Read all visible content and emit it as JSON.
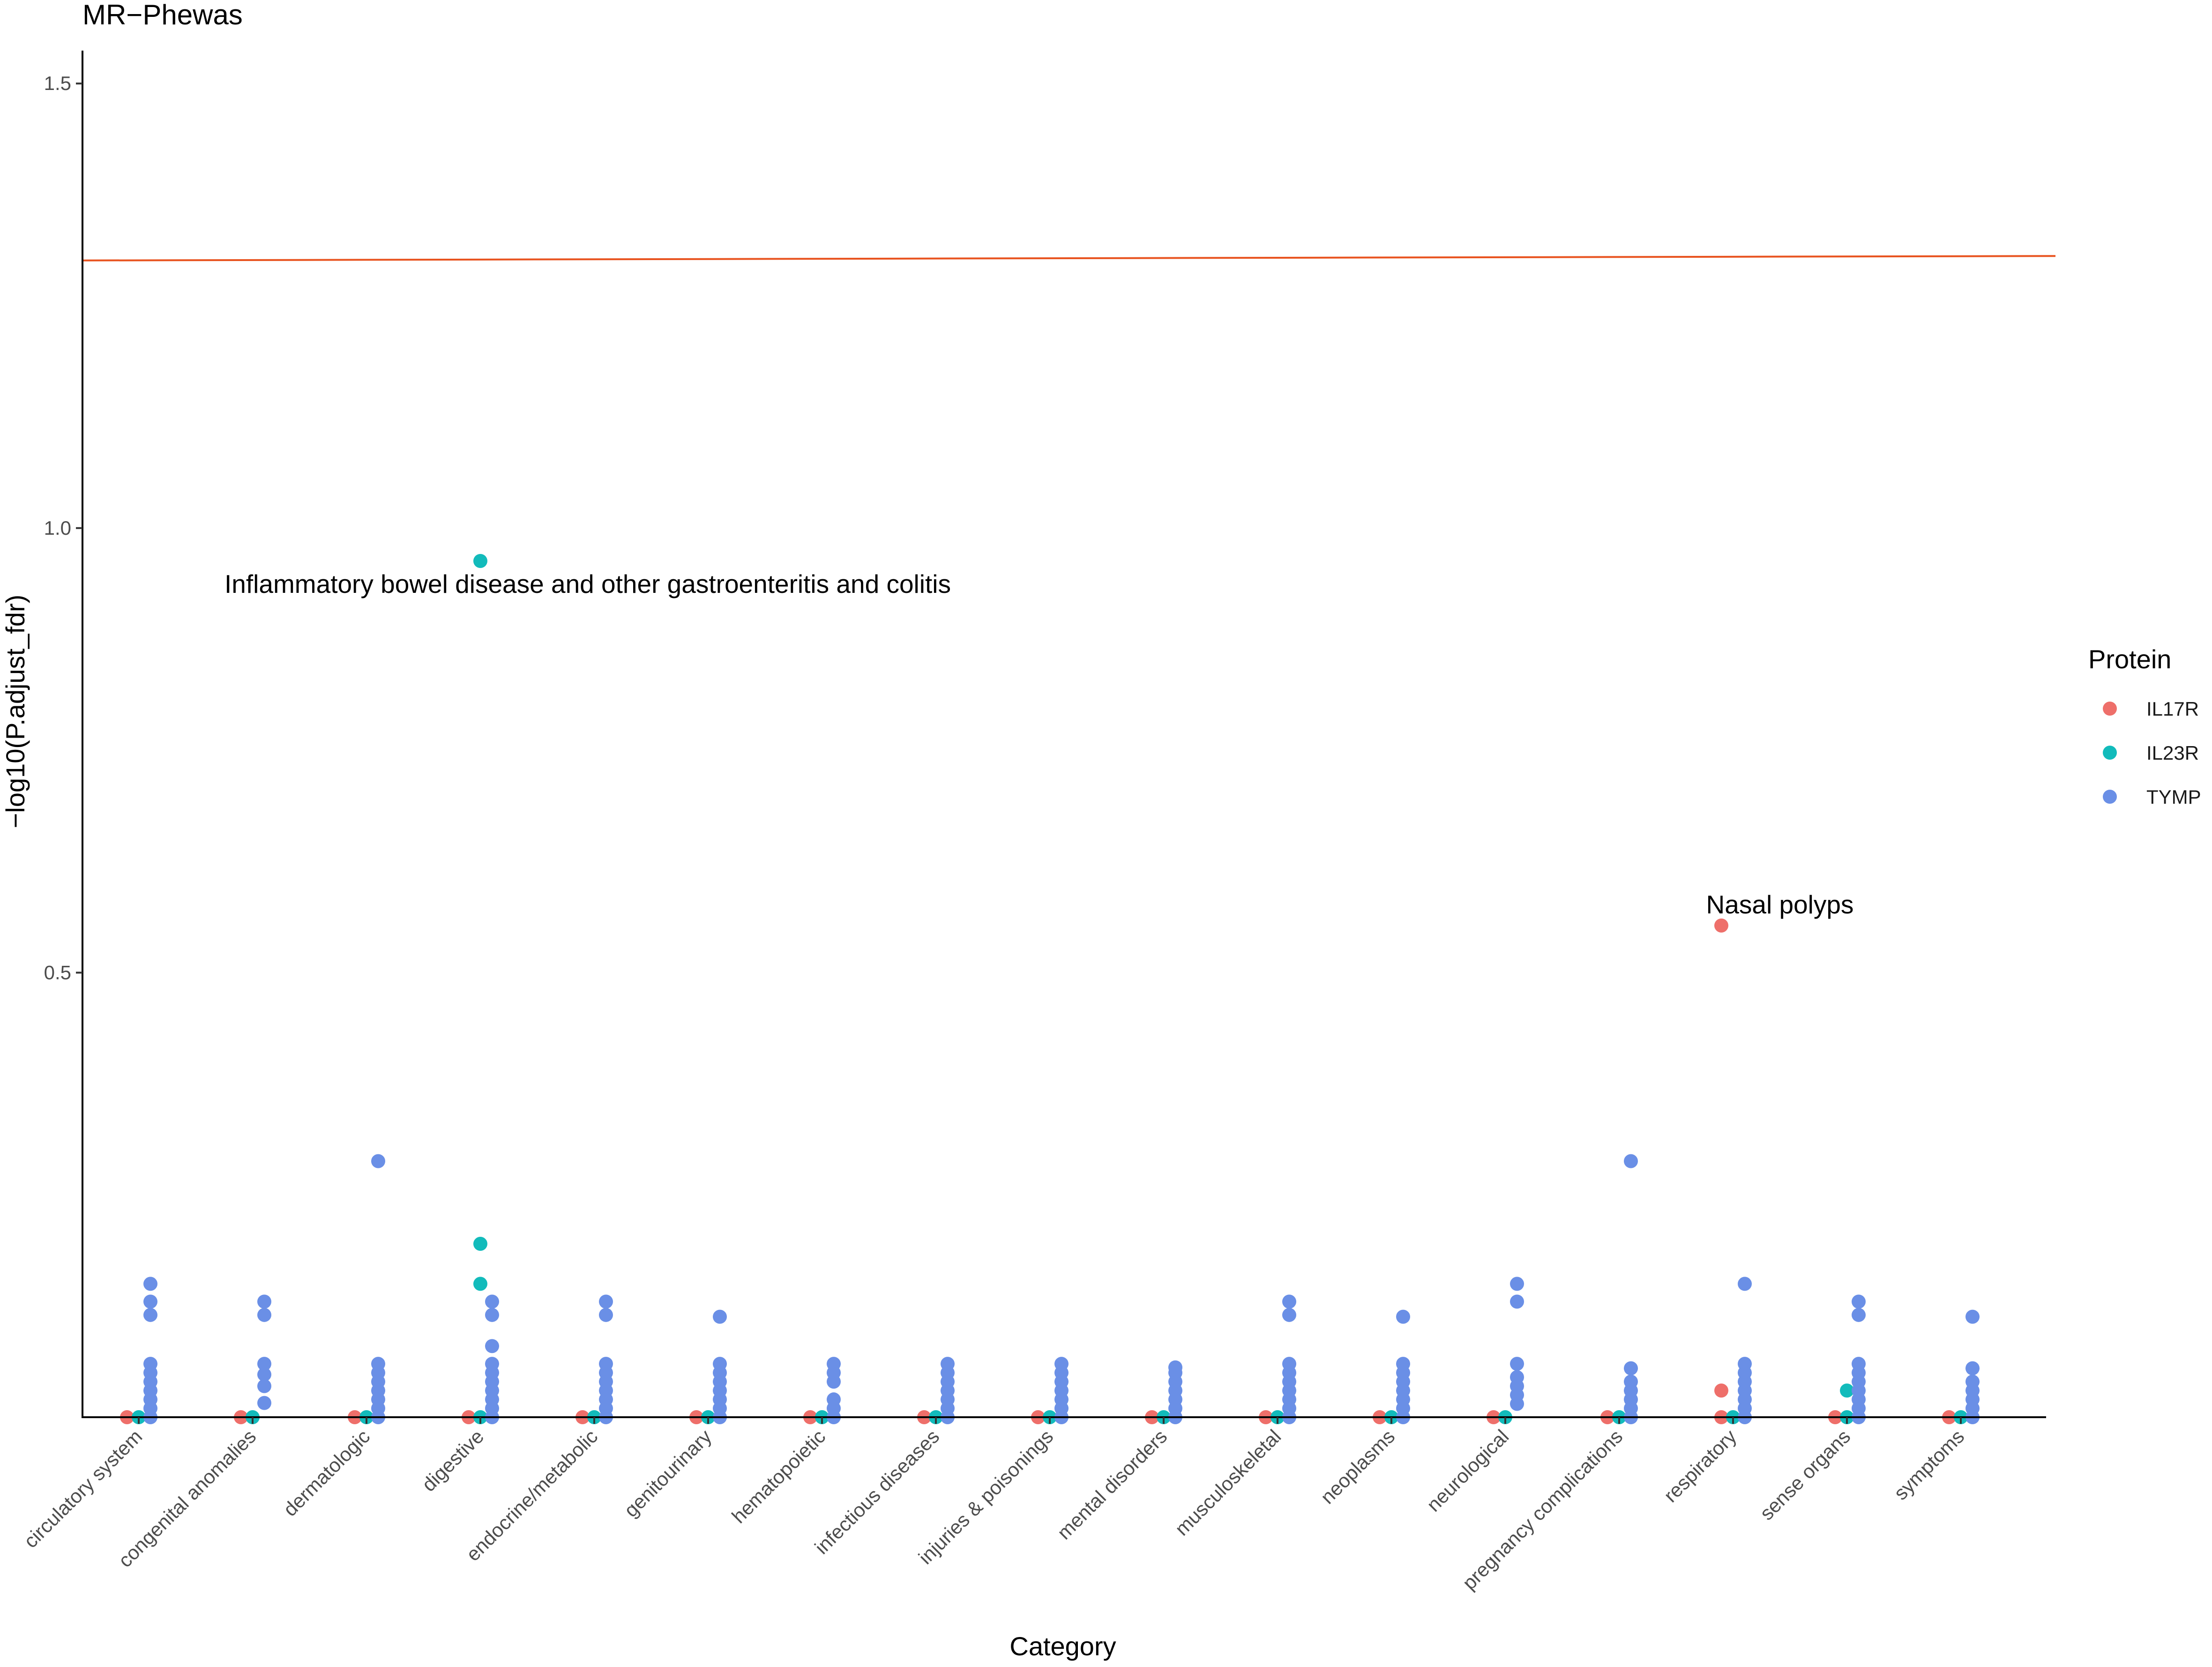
{
  "chart_data": {
    "type": "scatter",
    "title": "MR−Phewas",
    "xlabel": "Category",
    "ylabel": "−log10(P.adjust_fdr)",
    "ylim": [
      0,
      1.537
    ],
    "yticks": [
      0.5,
      1.0,
      1.5
    ],
    "ytick_labels": [
      "0.5",
      "1.0",
      "1.5"
    ],
    "categories": [
      "circulatory system",
      "congenital anomalies",
      "dermatologic",
      "digestive",
      "endocrine/metabolic",
      "genitourinary",
      "hematopoietic",
      "infectious diseases",
      "injuries & poisonings",
      "mental disorders",
      "musculoskeletal",
      "neoplasms",
      "neurological",
      "pregnancy complications",
      "respiratory",
      "sense organs",
      "symptoms"
    ],
    "threshold": {
      "y_start": 1.301,
      "y_end": 1.306,
      "color": "#e8531f"
    },
    "grid": false,
    "legend": {
      "title": "Protein",
      "position": "right",
      "entries": [
        {
          "name": "IL17R",
          "color": "#ee6f6a"
        },
        {
          "name": "IL23R",
          "color": "#12bbbb"
        },
        {
          "name": "TYMP",
          "color": "#6a8fe6"
        }
      ]
    },
    "series": [
      {
        "name": "IL17R",
        "color": "#ee6f6a",
        "points": [
          {
            "category": "circulatory system",
            "y": 0.0
          },
          {
            "category": "congenital anomalies",
            "y": 0.0
          },
          {
            "category": "dermatologic",
            "y": 0.0
          },
          {
            "category": "digestive",
            "y": 0.0
          },
          {
            "category": "endocrine/metabolic",
            "y": 0.0
          },
          {
            "category": "genitourinary",
            "y": 0.0
          },
          {
            "category": "hematopoietic",
            "y": 0.0
          },
          {
            "category": "infectious diseases",
            "y": 0.0
          },
          {
            "category": "injuries & poisonings",
            "y": 0.0
          },
          {
            "category": "mental disorders",
            "y": 0.0
          },
          {
            "category": "musculoskeletal",
            "y": 0.0
          },
          {
            "category": "neoplasms",
            "y": 0.0
          },
          {
            "category": "neurological",
            "y": 0.0
          },
          {
            "category": "pregnancy complications",
            "y": 0.0
          },
          {
            "category": "respiratory",
            "y": 0.0
          },
          {
            "category": "respiratory",
            "y": 0.03
          },
          {
            "category": "respiratory",
            "y": 0.553
          },
          {
            "category": "sense organs",
            "y": 0.0
          },
          {
            "category": "symptoms",
            "y": 0.0
          }
        ]
      },
      {
        "name": "IL23R",
        "color": "#12bbbb",
        "points": [
          {
            "category": "circulatory system",
            "y": 0.0
          },
          {
            "category": "congenital anomalies",
            "y": 0.0
          },
          {
            "category": "dermatologic",
            "y": 0.0
          },
          {
            "category": "digestive",
            "y": 0.0
          },
          {
            "category": "digestive",
            "y": 0.15
          },
          {
            "category": "digestive",
            "y": 0.195
          },
          {
            "category": "digestive",
            "y": 0.963
          },
          {
            "category": "endocrine/metabolic",
            "y": 0.0
          },
          {
            "category": "genitourinary",
            "y": 0.0
          },
          {
            "category": "hematopoietic",
            "y": 0.0
          },
          {
            "category": "infectious diseases",
            "y": 0.0
          },
          {
            "category": "injuries & poisonings",
            "y": 0.0
          },
          {
            "category": "mental disorders",
            "y": 0.0
          },
          {
            "category": "musculoskeletal",
            "y": 0.0
          },
          {
            "category": "neoplasms",
            "y": 0.0
          },
          {
            "category": "neurological",
            "y": 0.0
          },
          {
            "category": "pregnancy complications",
            "y": 0.0
          },
          {
            "category": "respiratory",
            "y": 0.0
          },
          {
            "category": "sense organs",
            "y": 0.0
          },
          {
            "category": "sense organs",
            "y": 0.03
          },
          {
            "category": "symptoms",
            "y": 0.0
          }
        ]
      },
      {
        "name": "TYMP",
        "color": "#6a8fe6",
        "points": [
          {
            "category": "circulatory system",
            "y": 0.0
          },
          {
            "category": "circulatory system",
            "y": 0.01
          },
          {
            "category": "circulatory system",
            "y": 0.02
          },
          {
            "category": "circulatory system",
            "y": 0.03
          },
          {
            "category": "circulatory system",
            "y": 0.04
          },
          {
            "category": "circulatory system",
            "y": 0.05
          },
          {
            "category": "circulatory system",
            "y": 0.06
          },
          {
            "category": "circulatory system",
            "y": 0.115
          },
          {
            "category": "circulatory system",
            "y": 0.13
          },
          {
            "category": "circulatory system",
            "y": 0.15
          },
          {
            "category": "congenital anomalies",
            "y": 0.016
          },
          {
            "category": "congenital anomalies",
            "y": 0.035
          },
          {
            "category": "congenital anomalies",
            "y": 0.048
          },
          {
            "category": "congenital anomalies",
            "y": 0.06
          },
          {
            "category": "congenital anomalies",
            "y": 0.115
          },
          {
            "category": "congenital anomalies",
            "y": 0.13
          },
          {
            "category": "dermatologic",
            "y": 0.0
          },
          {
            "category": "dermatologic",
            "y": 0.01
          },
          {
            "category": "dermatologic",
            "y": 0.02
          },
          {
            "category": "dermatologic",
            "y": 0.03
          },
          {
            "category": "dermatologic",
            "y": 0.04
          },
          {
            "category": "dermatologic",
            "y": 0.05
          },
          {
            "category": "dermatologic",
            "y": 0.06
          },
          {
            "category": "dermatologic",
            "y": 0.288
          },
          {
            "category": "digestive",
            "y": 0.0
          },
          {
            "category": "digestive",
            "y": 0.01
          },
          {
            "category": "digestive",
            "y": 0.02
          },
          {
            "category": "digestive",
            "y": 0.03
          },
          {
            "category": "digestive",
            "y": 0.04
          },
          {
            "category": "digestive",
            "y": 0.05
          },
          {
            "category": "digestive",
            "y": 0.06
          },
          {
            "category": "digestive",
            "y": 0.08
          },
          {
            "category": "digestive",
            "y": 0.115
          },
          {
            "category": "digestive",
            "y": 0.13
          },
          {
            "category": "endocrine/metabolic",
            "y": 0.0
          },
          {
            "category": "endocrine/metabolic",
            "y": 0.01
          },
          {
            "category": "endocrine/metabolic",
            "y": 0.02
          },
          {
            "category": "endocrine/metabolic",
            "y": 0.03
          },
          {
            "category": "endocrine/metabolic",
            "y": 0.04
          },
          {
            "category": "endocrine/metabolic",
            "y": 0.05
          },
          {
            "category": "endocrine/metabolic",
            "y": 0.06
          },
          {
            "category": "endocrine/metabolic",
            "y": 0.115
          },
          {
            "category": "endocrine/metabolic",
            "y": 0.13
          },
          {
            "category": "genitourinary",
            "y": 0.0
          },
          {
            "category": "genitourinary",
            "y": 0.01
          },
          {
            "category": "genitourinary",
            "y": 0.02
          },
          {
            "category": "genitourinary",
            "y": 0.03
          },
          {
            "category": "genitourinary",
            "y": 0.04
          },
          {
            "category": "genitourinary",
            "y": 0.05
          },
          {
            "category": "genitourinary",
            "y": 0.06
          },
          {
            "category": "genitourinary",
            "y": 0.113
          },
          {
            "category": "hematopoietic",
            "y": 0.0
          },
          {
            "category": "hematopoietic",
            "y": 0.01
          },
          {
            "category": "hematopoietic",
            "y": 0.02
          },
          {
            "category": "hematopoietic",
            "y": 0.04
          },
          {
            "category": "hematopoietic",
            "y": 0.05
          },
          {
            "category": "hematopoietic",
            "y": 0.06
          },
          {
            "category": "infectious diseases",
            "y": 0.0
          },
          {
            "category": "infectious diseases",
            "y": 0.01
          },
          {
            "category": "infectious diseases",
            "y": 0.02
          },
          {
            "category": "infectious diseases",
            "y": 0.03
          },
          {
            "category": "infectious diseases",
            "y": 0.04
          },
          {
            "category": "infectious diseases",
            "y": 0.05
          },
          {
            "category": "infectious diseases",
            "y": 0.06
          },
          {
            "category": "injuries & poisonings",
            "y": 0.0
          },
          {
            "category": "injuries & poisonings",
            "y": 0.01
          },
          {
            "category": "injuries & poisonings",
            "y": 0.02
          },
          {
            "category": "injuries & poisonings",
            "y": 0.03
          },
          {
            "category": "injuries & poisonings",
            "y": 0.04
          },
          {
            "category": "injuries & poisonings",
            "y": 0.05
          },
          {
            "category": "injuries & poisonings",
            "y": 0.06
          },
          {
            "category": "mental disorders",
            "y": 0.0
          },
          {
            "category": "mental disorders",
            "y": 0.01
          },
          {
            "category": "mental disorders",
            "y": 0.02
          },
          {
            "category": "mental disorders",
            "y": 0.03
          },
          {
            "category": "mental disorders",
            "y": 0.04
          },
          {
            "category": "mental disorders",
            "y": 0.05
          },
          {
            "category": "mental disorders",
            "y": 0.056
          },
          {
            "category": "musculoskeletal",
            "y": 0.0
          },
          {
            "category": "musculoskeletal",
            "y": 0.01
          },
          {
            "category": "musculoskeletal",
            "y": 0.02
          },
          {
            "category": "musculoskeletal",
            "y": 0.03
          },
          {
            "category": "musculoskeletal",
            "y": 0.04
          },
          {
            "category": "musculoskeletal",
            "y": 0.05
          },
          {
            "category": "musculoskeletal",
            "y": 0.06
          },
          {
            "category": "musculoskeletal",
            "y": 0.115
          },
          {
            "category": "musculoskeletal",
            "y": 0.13
          },
          {
            "category": "neoplasms",
            "y": 0.0
          },
          {
            "category": "neoplasms",
            "y": 0.01
          },
          {
            "category": "neoplasms",
            "y": 0.02
          },
          {
            "category": "neoplasms",
            "y": 0.03
          },
          {
            "category": "neoplasms",
            "y": 0.04
          },
          {
            "category": "neoplasms",
            "y": 0.05
          },
          {
            "category": "neoplasms",
            "y": 0.06
          },
          {
            "category": "neoplasms",
            "y": 0.113
          },
          {
            "category": "neurological",
            "y": 0.015
          },
          {
            "category": "neurological",
            "y": 0.025
          },
          {
            "category": "neurological",
            "y": 0.035
          },
          {
            "category": "neurological",
            "y": 0.045
          },
          {
            "category": "neurological",
            "y": 0.06
          },
          {
            "category": "neurological",
            "y": 0.13
          },
          {
            "category": "neurological",
            "y": 0.15
          },
          {
            "category": "pregnancy complications",
            "y": 0.0
          },
          {
            "category": "pregnancy complications",
            "y": 0.01
          },
          {
            "category": "pregnancy complications",
            "y": 0.02
          },
          {
            "category": "pregnancy complications",
            "y": 0.03
          },
          {
            "category": "pregnancy complications",
            "y": 0.04
          },
          {
            "category": "pregnancy complications",
            "y": 0.055
          },
          {
            "category": "pregnancy complications",
            "y": 0.288
          },
          {
            "category": "respiratory",
            "y": 0.0
          },
          {
            "category": "respiratory",
            "y": 0.01
          },
          {
            "category": "respiratory",
            "y": 0.02
          },
          {
            "category": "respiratory",
            "y": 0.03
          },
          {
            "category": "respiratory",
            "y": 0.04
          },
          {
            "category": "respiratory",
            "y": 0.05
          },
          {
            "category": "respiratory",
            "y": 0.06
          },
          {
            "category": "respiratory",
            "y": 0.15
          },
          {
            "category": "sense organs",
            "y": 0.0
          },
          {
            "category": "sense organs",
            "y": 0.01
          },
          {
            "category": "sense organs",
            "y": 0.02
          },
          {
            "category": "sense organs",
            "y": 0.03
          },
          {
            "category": "sense organs",
            "y": 0.04
          },
          {
            "category": "sense organs",
            "y": 0.05
          },
          {
            "category": "sense organs",
            "y": 0.06
          },
          {
            "category": "sense organs",
            "y": 0.115
          },
          {
            "category": "sense organs",
            "y": 0.13
          },
          {
            "category": "symptoms",
            "y": 0.0
          },
          {
            "category": "symptoms",
            "y": 0.01
          },
          {
            "category": "symptoms",
            "y": 0.02
          },
          {
            "category": "symptoms",
            "y": 0.03
          },
          {
            "category": "symptoms",
            "y": 0.04
          },
          {
            "category": "symptoms",
            "y": 0.055
          },
          {
            "category": "symptoms",
            "y": 0.113
          }
        ]
      }
    ],
    "annotations": [
      {
        "text": "Inflammatory bowel disease and other gastroenteritis and colitis",
        "category": "digestive",
        "y": 0.963
      },
      {
        "text": "Nasal polyps",
        "category": "respiratory",
        "y": 0.553
      }
    ]
  }
}
